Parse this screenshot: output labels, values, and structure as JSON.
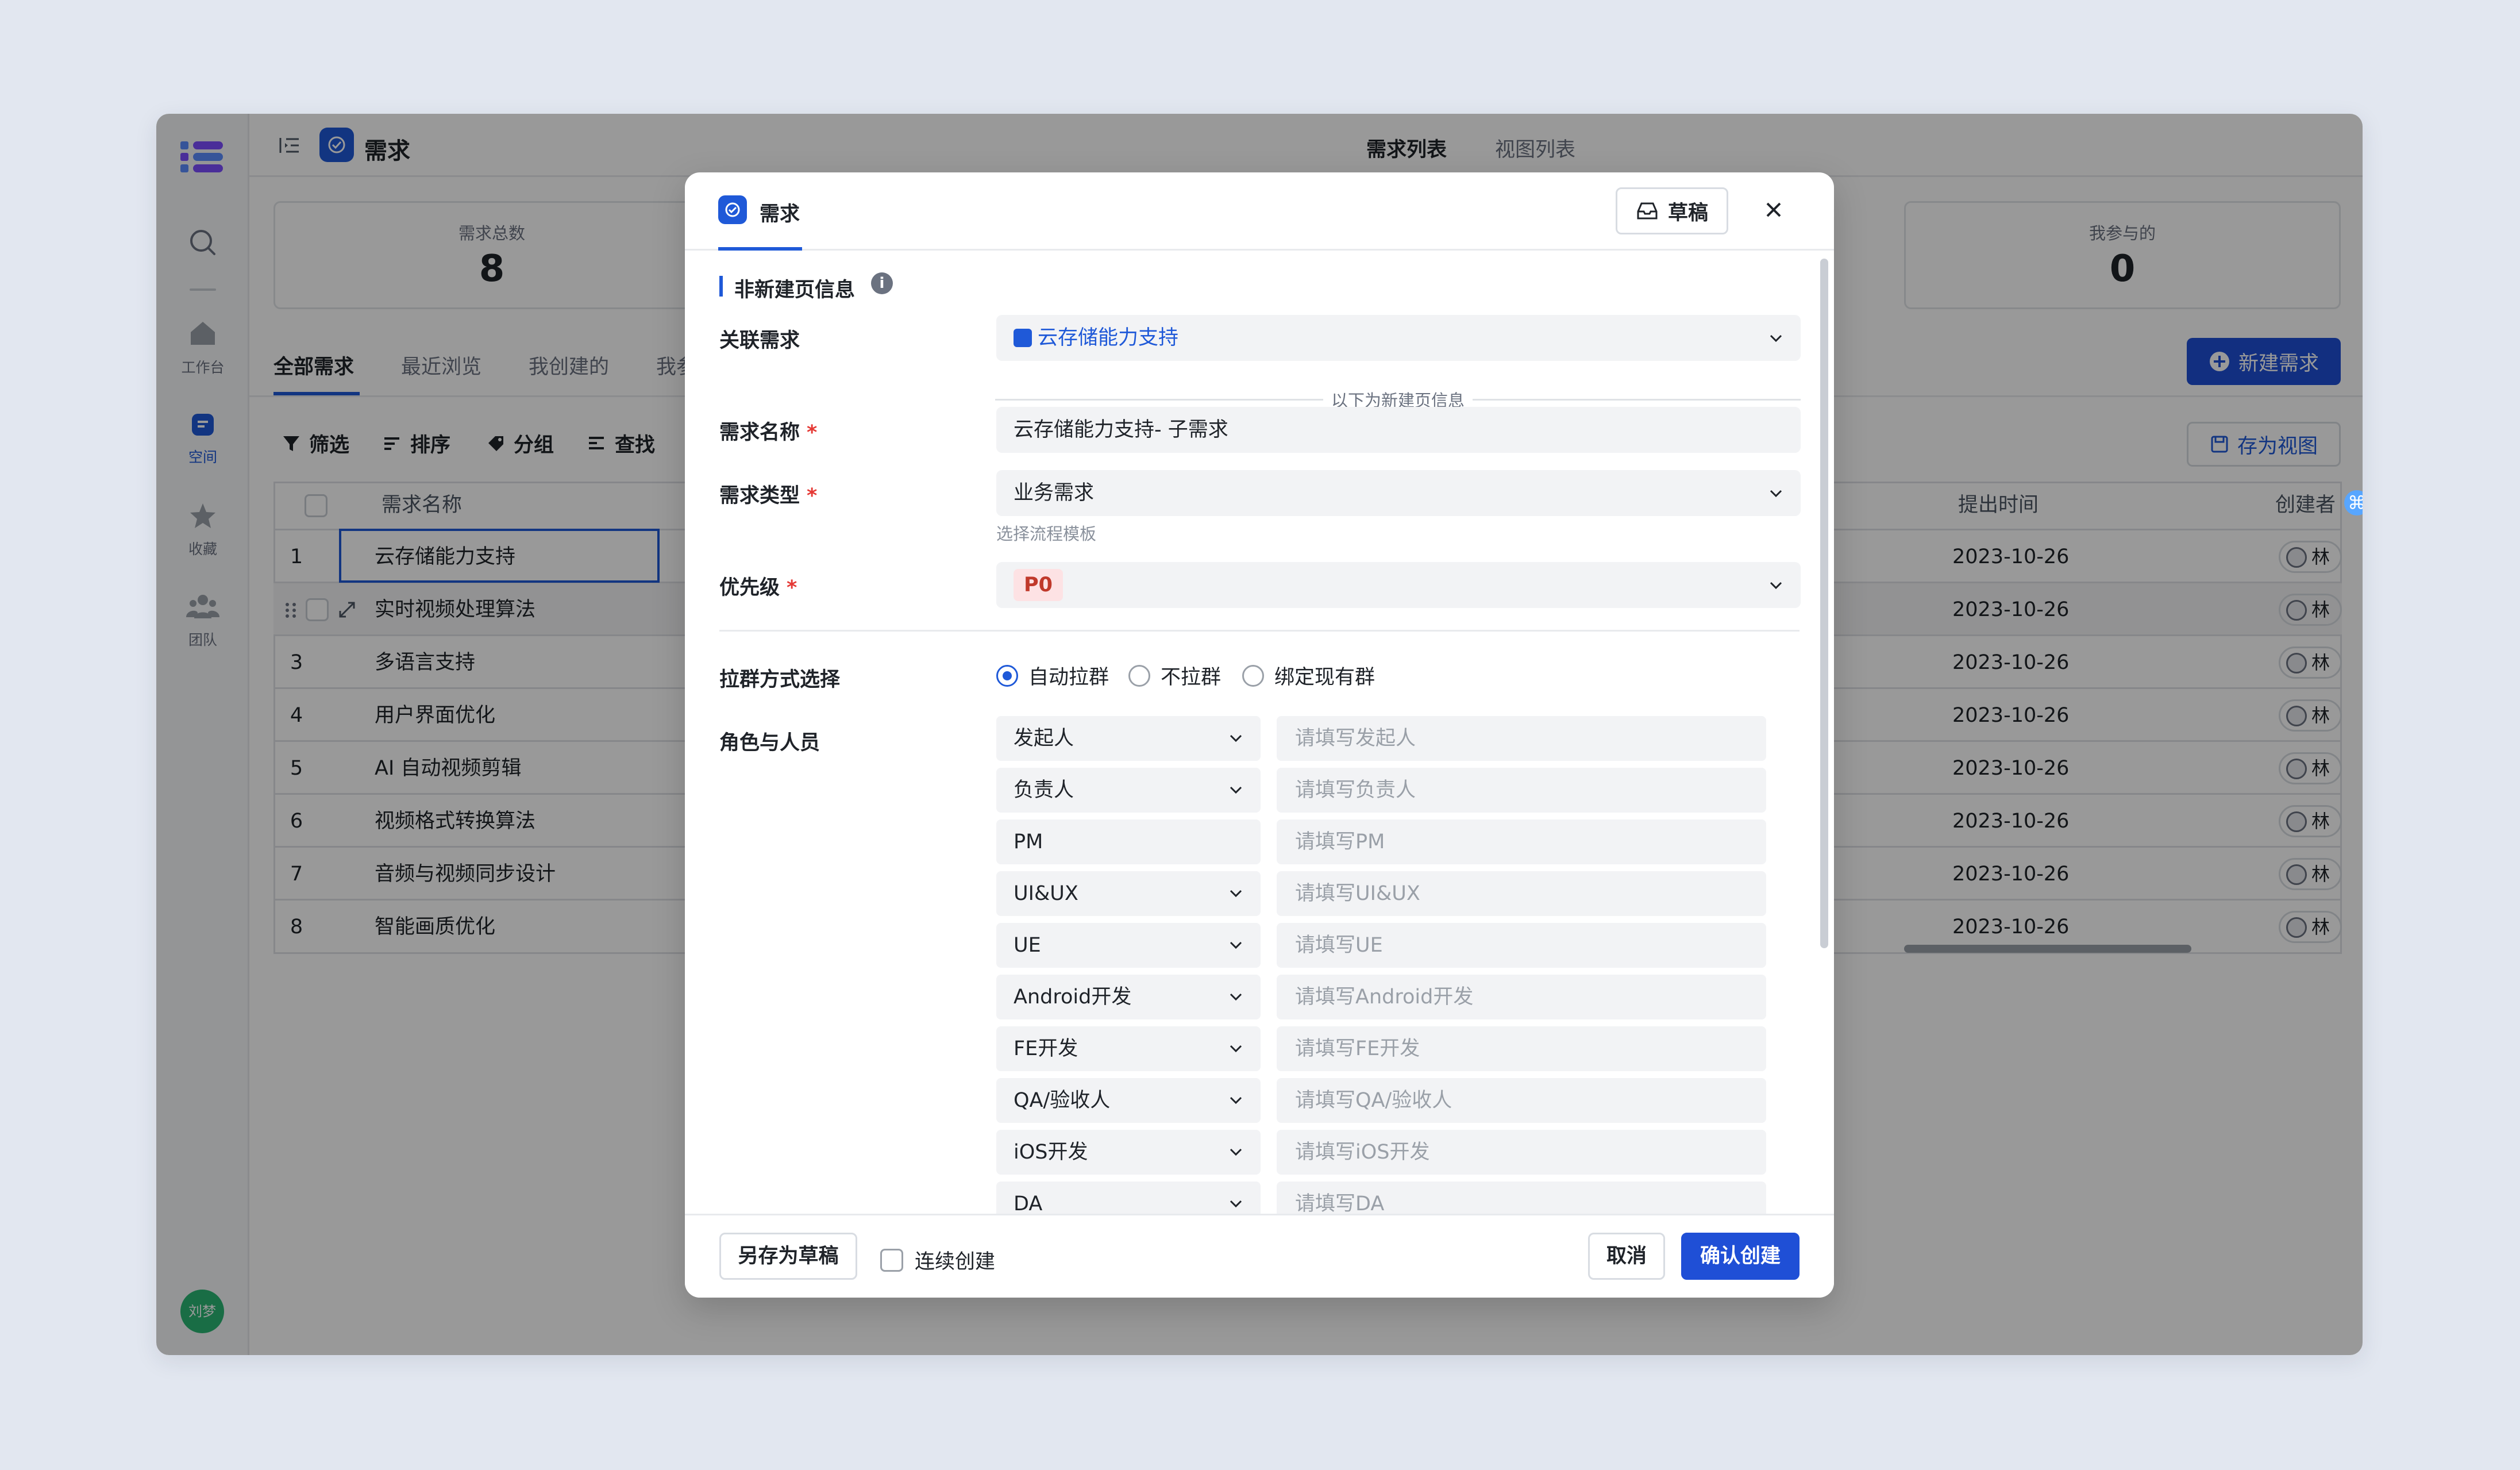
{
  "app": {
    "title": "需求",
    "tabs": [
      "需求列表",
      "视图列表"
    ]
  },
  "sidebar": {
    "items": [
      {
        "icon": "search-icon",
        "label": ""
      },
      {
        "icon": "home-icon",
        "label": "工作台"
      },
      {
        "icon": "space-icon",
        "label": "空间"
      },
      {
        "icon": "star-icon",
        "label": "收藏"
      },
      {
        "icon": "team-icon",
        "label": "团队"
      }
    ],
    "avatar": "刘梦"
  },
  "stats": [
    {
      "label": "需求总数",
      "value": "8"
    },
    {
      "label": "我参与的",
      "value": "0"
    }
  ],
  "subtabs": [
    "全部需求",
    "最近浏览",
    "我创建的",
    "我参"
  ],
  "toolbar": {
    "filter": "筛选",
    "sort": "排序",
    "group": "分组",
    "search": "查找",
    "new_button": "新建需求",
    "save_view": "存为视图"
  },
  "table": {
    "headers": {
      "name": "需求名称",
      "submit_time": "提出时间",
      "creator": "创建者"
    },
    "rows": [
      {
        "num": "1",
        "name": "云存储能力支持",
        "date": "2023-10-26",
        "creator": "林火"
      },
      {
        "num": "",
        "name": "实时视频处理算法",
        "date": "2023-10-26",
        "creator": "林火"
      },
      {
        "num": "3",
        "name": "多语言支持",
        "date": "2023-10-26",
        "creator": "林火"
      },
      {
        "num": "4",
        "name": "用户界面优化",
        "date": "2023-10-26",
        "creator": "林火"
      },
      {
        "num": "5",
        "name": "AI 自动视频剪辑",
        "date": "2023-10-26",
        "creator": "林火"
      },
      {
        "num": "6",
        "name": "视频格式转换算法",
        "date": "2023-10-26",
        "creator": "林火"
      },
      {
        "num": "7",
        "name": "音频与视频同步设计",
        "date": "2023-10-26",
        "creator": "林火"
      },
      {
        "num": "8",
        "name": "智能画质优化",
        "date": "2023-10-26",
        "creator": "林火"
      }
    ]
  },
  "modal": {
    "title": "需求",
    "draft_button": "草稿",
    "section_title": "非新建页信息",
    "related_label": "关联需求",
    "related_value": "云存储能力支持",
    "divider_text": "以下为新建页信息",
    "name_label": "需求名称",
    "name_value": "云存储能力支持- 子需求",
    "type_label": "需求类型",
    "type_value": "业务需求",
    "type_hint": "选择流程模板",
    "priority_label": "优先级",
    "priority_value": "P0",
    "group_label": "拉群方式选择",
    "group_options": [
      "自动拉群",
      "不拉群",
      "绑定现有群"
    ],
    "group_selected": "自动拉群",
    "roles_label": "角色与人员",
    "required_mark": "*",
    "roles": [
      {
        "role": "发起人",
        "placeholder": "请填写发起人",
        "dropdown": true
      },
      {
        "role": "负责人",
        "placeholder": "请填写负责人",
        "dropdown": true
      },
      {
        "role": "PM",
        "placeholder": "请填写PM",
        "dropdown": false
      },
      {
        "role": "UI&UX",
        "placeholder": "请填写UI&UX",
        "dropdown": true
      },
      {
        "role": "UE",
        "placeholder": "请填写UE",
        "dropdown": true
      },
      {
        "role": "Android开发",
        "placeholder": "请填写Android开发",
        "dropdown": true
      },
      {
        "role": "FE开发",
        "placeholder": "请填写FE开发",
        "dropdown": true
      },
      {
        "role": "QA/验收人",
        "placeholder": "请填写QA/验收人",
        "dropdown": true
      },
      {
        "role": "iOS开发",
        "placeholder": "请填写iOS开发",
        "dropdown": true
      },
      {
        "role": "DA",
        "placeholder": "请填写DA",
        "dropdown": true
      }
    ],
    "footer": {
      "save_draft": "另存为草稿",
      "continuous": "连续创建",
      "cancel": "取消",
      "confirm": "确认创建"
    }
  },
  "colors": {
    "accent": "#1f59d8",
    "primary_button": "#1f4fd6",
    "priority_bg": "#fde2e4",
    "priority_text": "#c0392b",
    "required": "#e53935"
  }
}
